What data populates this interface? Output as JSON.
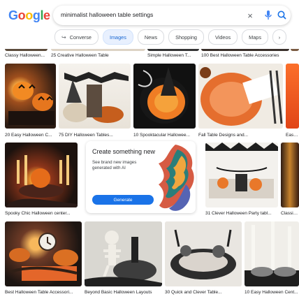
{
  "header": {
    "logo_letters": [
      {
        "letter": "G",
        "color": "#4285f4"
      },
      {
        "letter": "o",
        "color": "#ea4335"
      },
      {
        "letter": "o",
        "color": "#fbbc05"
      },
      {
        "letter": "g",
        "color": "#4285f4"
      },
      {
        "letter": "l",
        "color": "#34a853"
      },
      {
        "letter": "e",
        "color": "#ea4335"
      }
    ],
    "query": "minimalist halloween table settings",
    "clear_glyph": "×",
    "mic_icon": "microphone",
    "lens_icon": "search"
  },
  "chips": [
    {
      "label": "Converse",
      "icon": "↪"
    },
    {
      "label": "Images",
      "active": true
    },
    {
      "label": "News"
    },
    {
      "label": "Shopping"
    },
    {
      "label": "Videos"
    },
    {
      "label": "Maps"
    },
    {
      "label": "›",
      "narrow": true
    }
  ],
  "results": {
    "top_captions": [
      "Classy Halloween...",
      "25 Creative Halloween Table",
      "Simple Halloween T...",
      "100 Best Halloween Table Accessories"
    ],
    "row_1": [
      "20 Easy Halloween C...",
      "75 DIY Halloween Tables...",
      "10 Spooktacular Hallowee...",
      "Fall Table Designs and...",
      "Easy a..."
    ],
    "row_2": [
      "Spooky Chic Halloween center...",
      "31 Clever Halloween Party tabl...",
      "Classic F..."
    ],
    "row_3": [
      "Best Halloween Table Accessori...",
      "Beyond Basic Halloween Layouts",
      "30 Quick and Clever Table...",
      "10 Easy Halloween Cent..."
    ]
  },
  "promo": {
    "title": "Create something new",
    "description": "See brand new images generated with AI",
    "button": "Generate"
  },
  "colors": {
    "accent": "#1a73e8",
    "chip_active": "#e8f0fe"
  }
}
